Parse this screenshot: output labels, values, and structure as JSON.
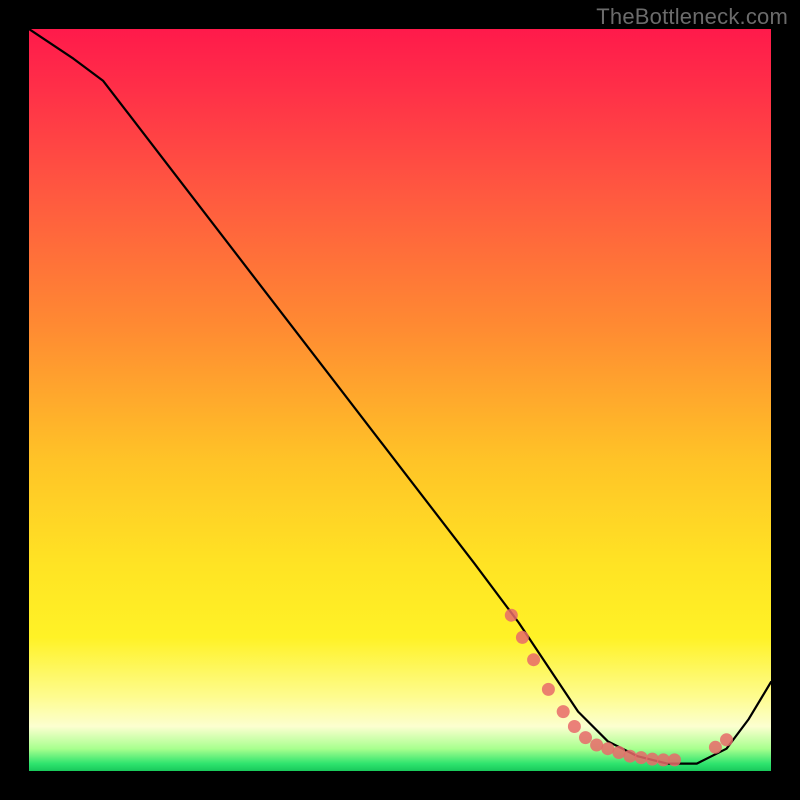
{
  "watermark": "TheBottleneck.com",
  "chart_data": {
    "type": "line",
    "title": "",
    "xlabel": "",
    "ylabel": "",
    "xlim": [
      0,
      100
    ],
    "ylim": [
      0,
      100
    ],
    "background_gradient": {
      "orientation": "vertical",
      "stops": [
        {
          "pos": 0,
          "color": "#ff1a4b"
        },
        {
          "pos": 22,
          "color": "#ff5840"
        },
        {
          "pos": 58,
          "color": "#ffc327"
        },
        {
          "pos": 82,
          "color": "#fff226"
        },
        {
          "pos": 94,
          "color": "#fcffd0"
        },
        {
          "pos": 100,
          "color": "#18c95b"
        }
      ]
    },
    "series": [
      {
        "name": "bottleneck-curve",
        "color": "#000000",
        "x": [
          0,
          6,
          10,
          20,
          30,
          40,
          50,
          60,
          66,
          70,
          74,
          78,
          82,
          86,
          90,
          94,
          97,
          100
        ],
        "y": [
          100,
          96,
          93,
          80,
          67,
          54,
          41,
          28,
          20,
          14,
          8,
          4,
          2,
          1,
          1,
          3,
          7,
          12
        ]
      }
    ],
    "markers": {
      "name": "highlight-points",
      "color": "#e86a6a",
      "x": [
        65,
        66.5,
        68,
        70,
        72,
        73.5,
        75,
        76.5,
        78,
        79.5,
        81,
        82.5,
        84,
        85.5,
        87,
        92.5,
        94
      ],
      "y": [
        21,
        18,
        15,
        11,
        8,
        6,
        4.5,
        3.5,
        3,
        2.5,
        2,
        1.8,
        1.6,
        1.5,
        1.5,
        3.2,
        4.2
      ]
    }
  }
}
